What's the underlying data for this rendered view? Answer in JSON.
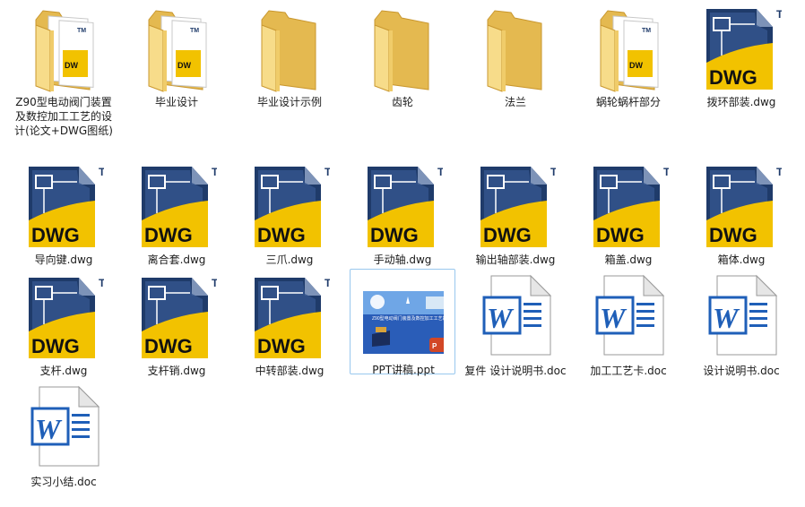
{
  "items": [
    {
      "label": "Z90型电动阀门装置及数控加工工艺的设计(论文+DWG图纸)",
      "type": "folder-docs",
      "col": 0,
      "row": 0
    },
    {
      "label": "毕业设计",
      "type": "folder-docs",
      "col": 1,
      "row": 0
    },
    {
      "label": "毕业设计示例",
      "type": "folder",
      "col": 2,
      "row": 0
    },
    {
      "label": "齿轮",
      "type": "folder",
      "col": 3,
      "row": 0
    },
    {
      "label": "法兰",
      "type": "folder",
      "col": 4,
      "row": 0
    },
    {
      "label": "蜗轮蜗杆部分",
      "type": "folder-docs",
      "col": 5,
      "row": 0
    },
    {
      "label": "拨环部装.dwg",
      "type": "dwg",
      "col": 6,
      "row": 0
    },
    {
      "label": "导向键.dwg",
      "type": "dwg",
      "col": 0,
      "row": 1
    },
    {
      "label": "离合套.dwg",
      "type": "dwg",
      "col": 1,
      "row": 1
    },
    {
      "label": "三爪.dwg",
      "type": "dwg",
      "col": 2,
      "row": 1
    },
    {
      "label": "手动轴.dwg",
      "type": "dwg",
      "col": 3,
      "row": 1
    },
    {
      "label": "输出轴部装.dwg",
      "type": "dwg",
      "col": 4,
      "row": 1
    },
    {
      "label": "箱盖.dwg",
      "type": "dwg",
      "col": 5,
      "row": 1
    },
    {
      "label": "箱体.dwg",
      "type": "dwg",
      "col": 6,
      "row": 1
    },
    {
      "label": "支杆.dwg",
      "type": "dwg",
      "col": 0,
      "row": 2
    },
    {
      "label": "支杆销.dwg",
      "type": "dwg",
      "col": 1,
      "row": 2
    },
    {
      "label": "中转部装.dwg",
      "type": "dwg",
      "col": 2,
      "row": 2
    },
    {
      "label": "PPT讲稿.ppt",
      "type": "ppt",
      "col": 3,
      "row": 2,
      "selected": true
    },
    {
      "label": "复件 设计说明书.doc",
      "type": "doc",
      "col": 4,
      "row": 2
    },
    {
      "label": "加工工艺卡.doc",
      "type": "doc",
      "col": 5,
      "row": 2
    },
    {
      "label": "设计说明书.doc",
      "type": "doc",
      "col": 6,
      "row": 2
    },
    {
      "label": "实习小结.doc",
      "type": "doc",
      "col": 0,
      "row": 3
    }
  ],
  "icon_text": {
    "dwg": "DWG",
    "tm": "TM",
    "word": "W",
    "ppt_title": "Z90型电动阀门装置及数控加工工艺的设计"
  },
  "colors": {
    "folder": "#f3d37a",
    "dwg_navy": "#1f3b6a",
    "dwg_yellow": "#f2c200",
    "word_blue": "#1f5fb8",
    "selection_border": "#99c8ee"
  }
}
